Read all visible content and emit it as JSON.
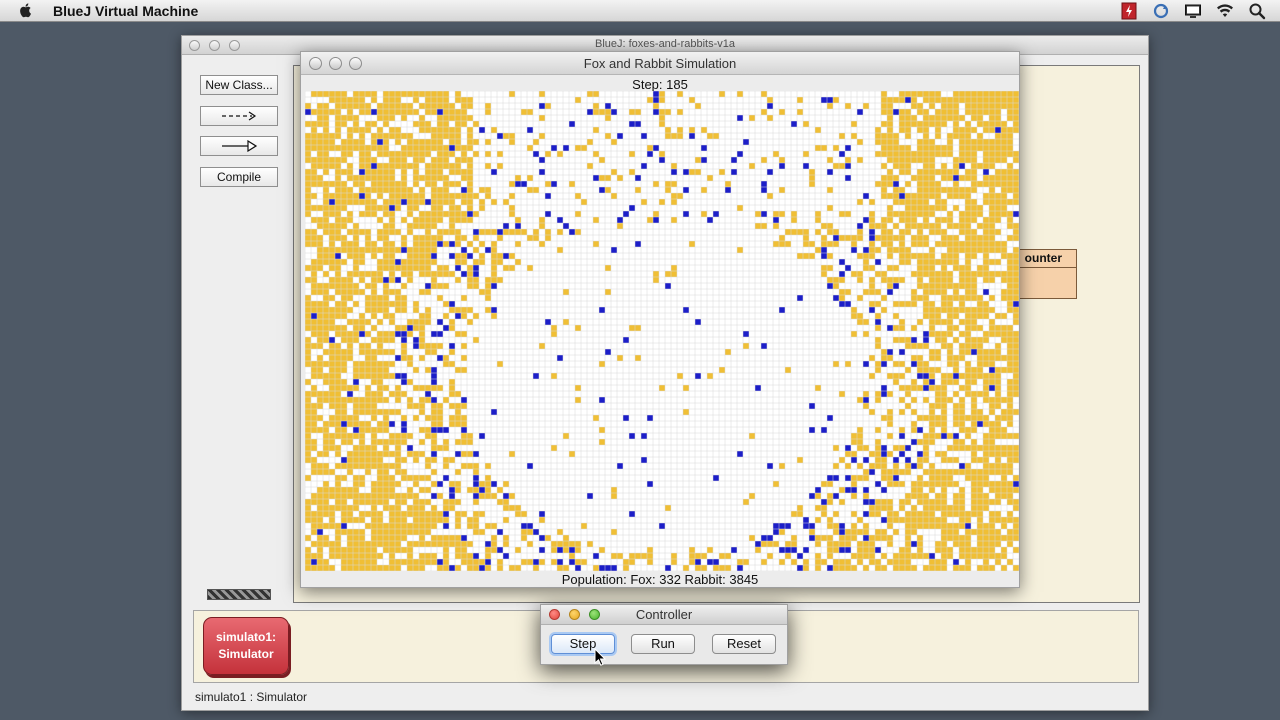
{
  "menubar": {
    "app_name": "BlueJ Virtual Machine",
    "icons": [
      "apple-icon",
      "flash-icon",
      "sync-icon",
      "display-icon",
      "wifi-icon",
      "spotlight-icon"
    ]
  },
  "bluej": {
    "window_title": "BlueJ: foxes-and-rabbits-v1a",
    "toolbar": {
      "new_class_label": "New Class...",
      "uses_arrow": "uses-arrow-icon",
      "inherits_arrow": "inheritance-arrow-icon",
      "compile_label": "Compile"
    },
    "counter_class_label": "ounter",
    "object_bench": {
      "object_label_line1": "simulato1:",
      "object_label_line2": "Simulator",
      "object_color": "#d9434c"
    },
    "status_text": "simulato1 : Simulator"
  },
  "simulation": {
    "title": "Fox and Rabbit Simulation",
    "step_text": "Step: 185",
    "population_text": "Population: Fox: 332 Rabbit: 3845",
    "step": 185,
    "fox_count": 332,
    "rabbit_count": 3845,
    "colors": {
      "rabbit": "#f0bf35",
      "fox": "#1c1ec8",
      "empty": "#ffffff",
      "grid": "#d8d8d8"
    }
  },
  "controller": {
    "title": "Controller",
    "step_label": "Step",
    "run_label": "Run",
    "reset_label": "Reset"
  }
}
